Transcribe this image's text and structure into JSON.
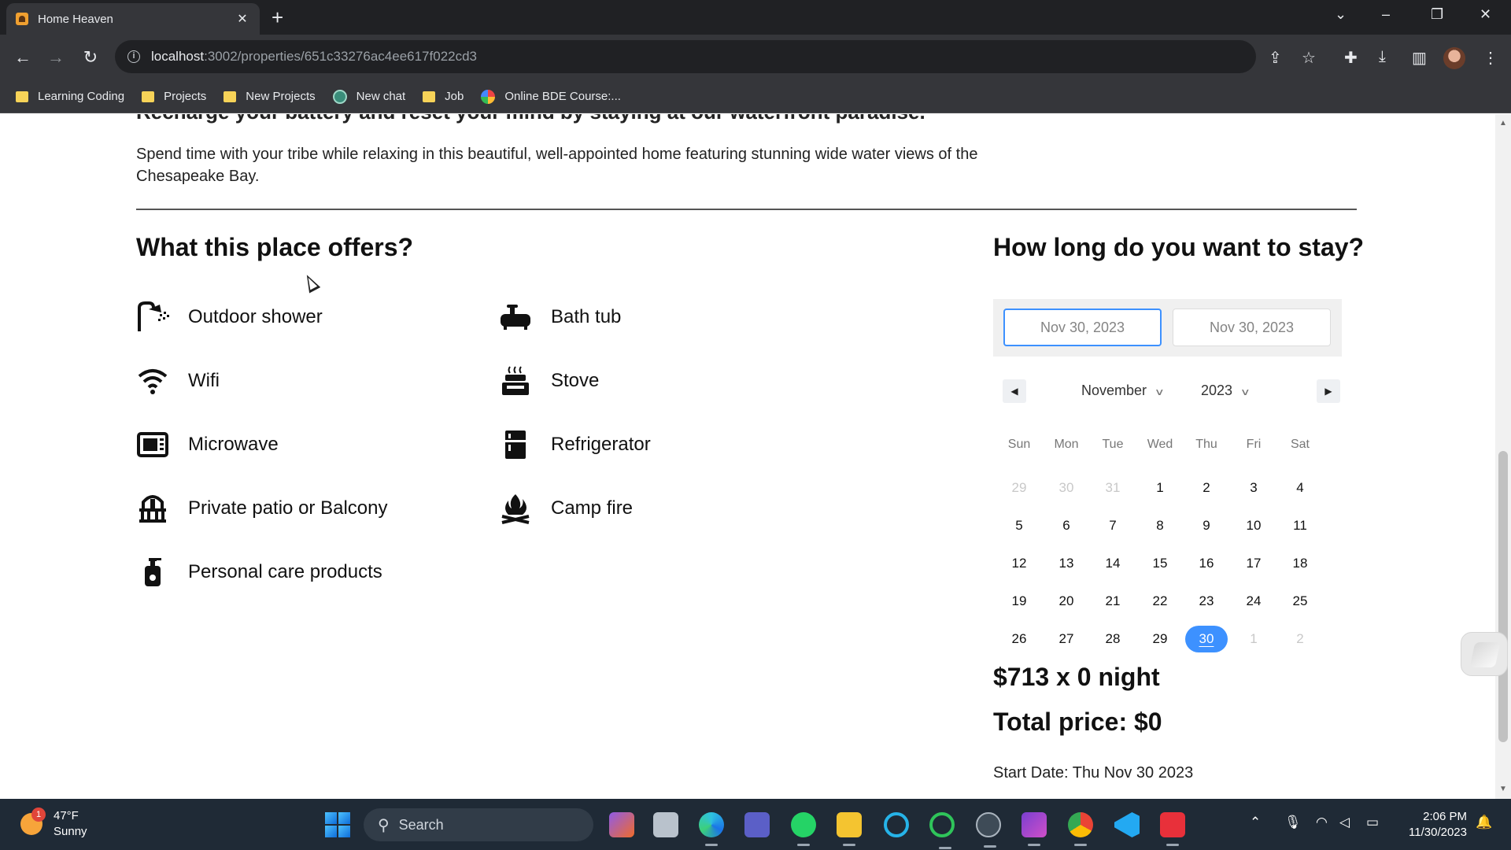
{
  "browser": {
    "tab_title": "Home Heaven",
    "tab_close": "✕",
    "new_tab": "+",
    "url_host": "localhost",
    "url_path": ":3002/properties/651c33276ac4ee617f022cd3",
    "bookmarks": [
      {
        "label": "Learning Coding",
        "icon": "folder-icon"
      },
      {
        "label": "Projects",
        "icon": "folder-icon"
      },
      {
        "label": "New Projects",
        "icon": "folder-icon"
      },
      {
        "label": "New chat",
        "icon": "chatgpt-icon"
      },
      {
        "label": "Job",
        "icon": "folder-icon"
      },
      {
        "label": "Online BDE Course:...",
        "icon": "site-icon"
      }
    ]
  },
  "page": {
    "cut_heading": "Recharge your battery and reset your mind by staying at our waterfront paradise.",
    "intro": "Spend time with your tribe while relaxing in this beautiful, well-appointed home featuring stunning wide water views of the Chesapeake Bay.",
    "offers_title": "What this place offers?",
    "amenities": [
      {
        "label": "Outdoor shower",
        "icon": "shower-icon"
      },
      {
        "label": "Bath tub",
        "icon": "bathtub-icon"
      },
      {
        "label": "Wifi",
        "icon": "wifi-icon"
      },
      {
        "label": "Stove",
        "icon": "stove-icon"
      },
      {
        "label": "Microwave",
        "icon": "microwave-icon"
      },
      {
        "label": "Refrigerator",
        "icon": "refrigerator-icon"
      },
      {
        "label": "Private patio or Balcony",
        "icon": "balcony-icon"
      },
      {
        "label": "Camp fire",
        "icon": "campfire-icon"
      },
      {
        "label": "Personal care products",
        "icon": "soap-bottle-icon"
      }
    ],
    "stay_title": "How long do you want to stay?",
    "start_date_input": "Nov 30, 2023",
    "end_date_input": "Nov 30, 2023",
    "calendar": {
      "month": "November",
      "year": "2023",
      "weekdays": [
        "Sun",
        "Mon",
        "Tue",
        "Wed",
        "Thu",
        "Fri",
        "Sat"
      ],
      "weeks": [
        [
          {
            "d": "29",
            "m": true
          },
          {
            "d": "30",
            "m": true
          },
          {
            "d": "31",
            "m": true
          },
          {
            "d": "1"
          },
          {
            "d": "2"
          },
          {
            "d": "3"
          },
          {
            "d": "4"
          }
        ],
        [
          {
            "d": "5"
          },
          {
            "d": "6"
          },
          {
            "d": "7"
          },
          {
            "d": "8"
          },
          {
            "d": "9"
          },
          {
            "d": "10"
          },
          {
            "d": "11"
          }
        ],
        [
          {
            "d": "12"
          },
          {
            "d": "13"
          },
          {
            "d": "14"
          },
          {
            "d": "15"
          },
          {
            "d": "16"
          },
          {
            "d": "17"
          },
          {
            "d": "18"
          }
        ],
        [
          {
            "d": "19"
          },
          {
            "d": "20"
          },
          {
            "d": "21"
          },
          {
            "d": "22"
          },
          {
            "d": "23"
          },
          {
            "d": "24"
          },
          {
            "d": "25"
          }
        ],
        [
          {
            "d": "26"
          },
          {
            "d": "27"
          },
          {
            "d": "28"
          },
          {
            "d": "29"
          },
          {
            "d": "30",
            "sel": true
          },
          {
            "d": "1",
            "m": true
          },
          {
            "d": "2",
            "m": true
          }
        ]
      ]
    },
    "price_line": "$713 x 0 night",
    "total_line": "Total price: $0",
    "start_line": "Start Date: Thu Nov 30 2023"
  },
  "taskbar": {
    "weather_temp": "47°F",
    "weather_desc": "Sunny",
    "weather_badge": "1",
    "search_label": "Search",
    "time": "2:06 PM",
    "date": "11/30/2023"
  },
  "colors": {
    "accent": "#3d91ff",
    "chrome_dark": "#202124",
    "chrome_toolbar": "#35363a",
    "taskbar": "#1f2a36"
  }
}
